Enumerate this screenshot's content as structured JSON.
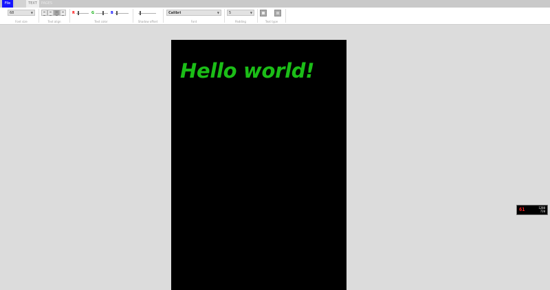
{
  "tabs": {
    "file": "File",
    "text": "TEXT",
    "pages": "PAGES"
  },
  "ribbon": {
    "font_size": {
      "value": "68",
      "label": "Font size"
    },
    "text_align": {
      "label": "Text align",
      "selected": "center"
    },
    "text_color": {
      "label": "Text color",
      "r": "R",
      "g": "G",
      "b": "B"
    },
    "shadow_offset": {
      "label": "Shadow offset"
    },
    "font": {
      "value": "Calibri",
      "label": "Font"
    },
    "padding": {
      "value": "5",
      "label": "Padding"
    },
    "text_type": {
      "label": "Text type"
    }
  },
  "canvas": {
    "text": "Hello world!",
    "text_color": "#1bbd17",
    "background": "#000000"
  },
  "fps": {
    "value": "61",
    "line1": "1280",
    "line2": "720"
  },
  "colors": {
    "file_tab": "#1515ff",
    "workspace": "#dcdcdc",
    "red_channel": "#ff0000",
    "green_channel": "#00aa00",
    "blue_channel": "#0000ff"
  }
}
